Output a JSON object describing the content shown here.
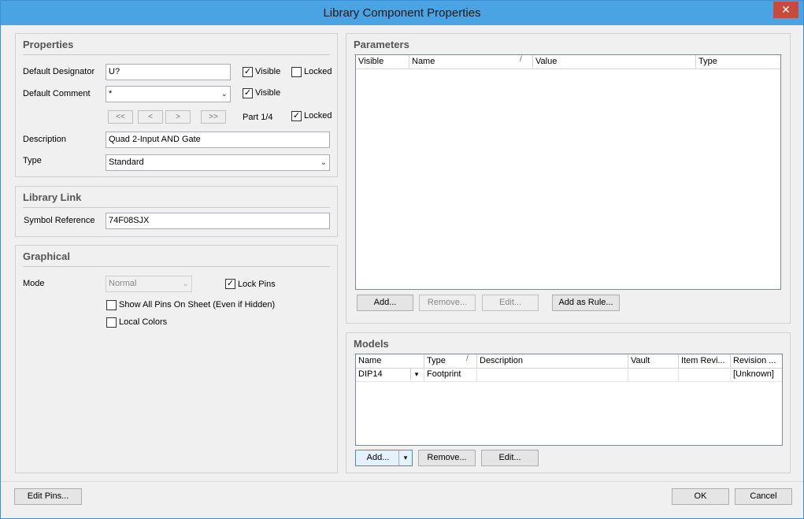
{
  "window": {
    "title": "Library Component Properties",
    "close_glyph": "✕"
  },
  "properties": {
    "title": "Properties",
    "default_designator_label": "Default Designator",
    "default_designator_value": "U?",
    "designator_visible_label": "Visible",
    "designator_locked_label": "Locked",
    "default_comment_label": "Default Comment",
    "default_comment_value": "*",
    "comment_visible_label": "Visible",
    "nav": {
      "first": "<<",
      "prev": "<",
      "next": ">",
      "last": ">>"
    },
    "part_label": "Part 1/4",
    "part_locked_label": "Locked",
    "description_label": "Description",
    "description_value": "Quad 2-Input AND Gate",
    "type_label": "Type",
    "type_value": "Standard"
  },
  "library_link": {
    "title": "Library Link",
    "symbol_reference_label": "Symbol Reference",
    "symbol_reference_value": "74F08SJX"
  },
  "graphical": {
    "title": "Graphical",
    "mode_label": "Mode",
    "mode_value": "Normal",
    "lock_pins_label": "Lock Pins",
    "show_all_pins_label": "Show All Pins On Sheet (Even if Hidden)",
    "local_colors_label": "Local Colors"
  },
  "parameters": {
    "title": "Parameters",
    "columns": [
      "Visible",
      "Name",
      "Value",
      "Type"
    ],
    "buttons": {
      "add": "Add...",
      "remove": "Remove...",
      "edit": "Edit...",
      "add_as_rule": "Add as Rule..."
    }
  },
  "models": {
    "title": "Models",
    "columns": [
      "Name",
      "Type",
      "Description",
      "Vault",
      "Item Revi...",
      "Revision ..."
    ],
    "rows": [
      {
        "name": "DIP14",
        "type": "Footprint",
        "description": "",
        "vault": "",
        "item_revision": "",
        "revision": "[Unknown]"
      }
    ],
    "buttons": {
      "add": "Add...",
      "remove": "Remove...",
      "edit": "Edit..."
    }
  },
  "footer": {
    "edit_pins": "Edit Pins...",
    "ok": "OK",
    "cancel": "Cancel"
  },
  "checks": {
    "designator_visible": "✓",
    "comment_visible": "✓",
    "part_locked": "✓",
    "lock_pins": "✓"
  },
  "colors": {
    "titlebar": "#4aa3e2",
    "close": "#c74a3c",
    "dialog_bg": "#f0f0f0"
  }
}
